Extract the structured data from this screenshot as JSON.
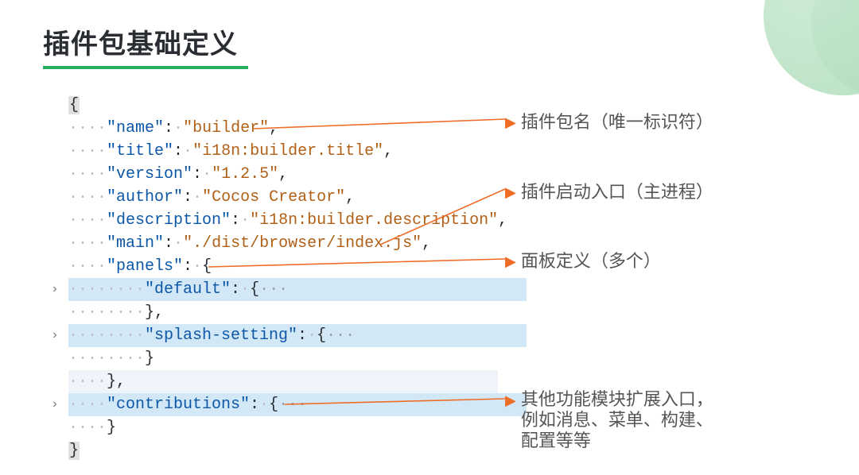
{
  "title": "插件包基础定义",
  "code": {
    "open_brace": "{",
    "name_key": "\"name\"",
    "name_val": "\"builder\"",
    "title_key": "\"title\"",
    "title_val": "\"i18n:builder.title\"",
    "version_key": "\"version\"",
    "version_val": "\"1.2.5\"",
    "author_key": "\"author\"",
    "author_val": "\"Cocos Creator\"",
    "description_key": "\"description\"",
    "description_val": "\"i18n:builder.description\"",
    "main_key": "\"main\"",
    "main_val": "\"./dist/browser/index.js\"",
    "panels_key": "\"panels\"",
    "default_key": "\"default\"",
    "splash_key": "\"splash-setting\"",
    "contributions_key": "\"contributions\"",
    "close_brace": "}"
  },
  "annotations": {
    "a1": "插件包名（唯一标识符）",
    "a2": "插件启动入口（主进程）",
    "a3": "面板定义（多个）",
    "a4_l1": "其他功能模块扩展入口，",
    "a4_l2": "例如消息、菜单、构建、",
    "a4_l3": "配置等等"
  }
}
